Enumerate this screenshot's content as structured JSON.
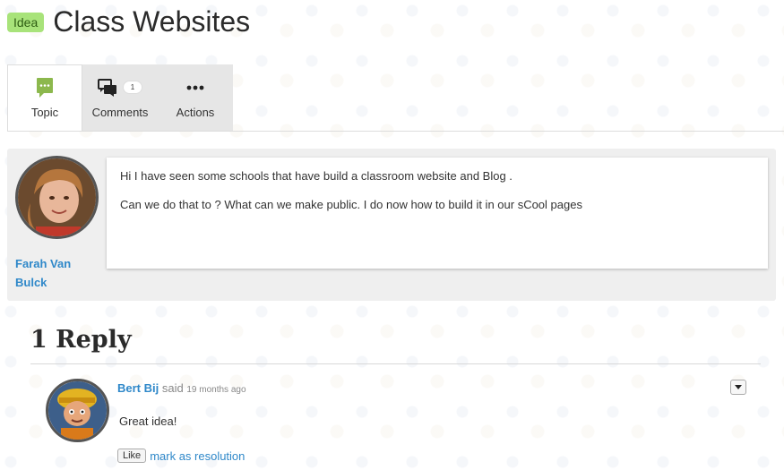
{
  "header": {
    "badge": "Idea",
    "title": "Class Websites"
  },
  "tabs": [
    {
      "label": "Topic",
      "icon": "topic-icon"
    },
    {
      "label": "Comments",
      "icon": "comments-icon",
      "count": "1"
    },
    {
      "label": "Actions",
      "icon": "more-icon"
    }
  ],
  "topic": {
    "author": "Farah Van Bulck",
    "lines": [
      "Hi I have seen some schools that have build a classroom website and Blog .",
      "Can we do that to ? What can we make public. I do now how to build it in our sCool pages"
    ]
  },
  "replies": {
    "heading": "1 Reply",
    "items": [
      {
        "author": "Bert Bij",
        "said": "said",
        "time": "19 months ago",
        "text": "Great idea!",
        "like_label": "Like",
        "resolution_label": "mark as resolution"
      }
    ]
  },
  "colors": {
    "badge": "#a8e37a",
    "link": "#2f88c9",
    "topic_icon": "#8cb84d"
  }
}
